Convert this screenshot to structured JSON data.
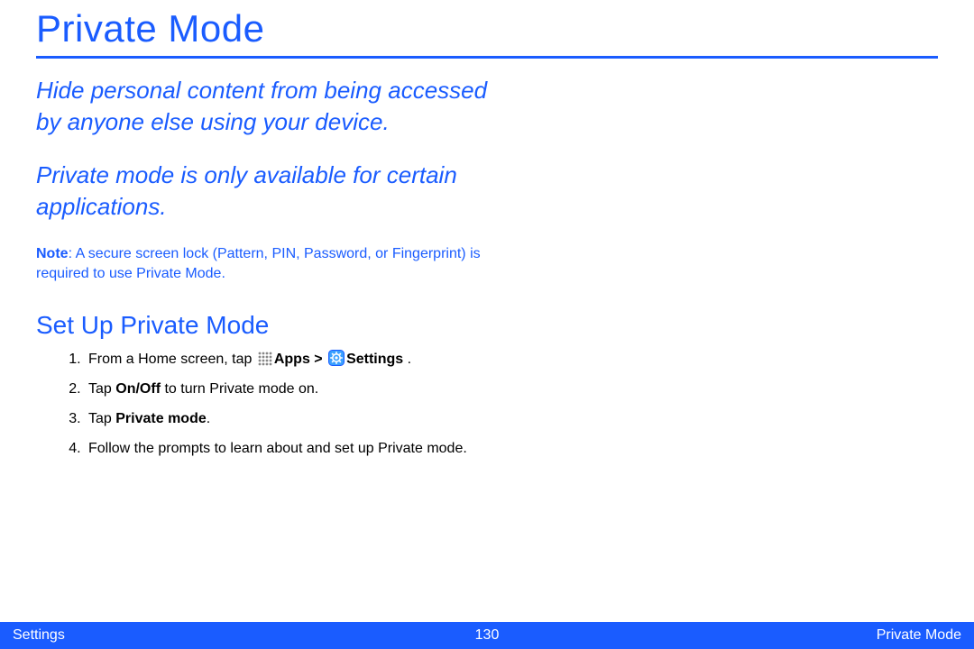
{
  "title": "Private Mode",
  "intro": {
    "p1": "Hide personal content from being accessed by anyone else using your device.",
    "p2": "Private mode is only available for certain applications."
  },
  "note": {
    "label": "Note",
    "text": ": A secure screen lock (Pattern, PIN, Password, or Fingerprint) is required to use Private Mode."
  },
  "section_heading": "Set Up Private Mode",
  "steps": {
    "s1_a": "From a Home screen, tap ",
    "s1_apps": "Apps",
    "s1_sep": " > ",
    "s1_settings": "Settings",
    "s1_end": " .",
    "s2_a": "Tap ",
    "s2_b": "On/Off",
    "s2_c": " to turn Private mode on.",
    "s3_a": "Tap ",
    "s3_b": "Private mode",
    "s3_c": ".",
    "s4": "Follow the prompts to learn about and set up Private mode."
  },
  "footer": {
    "left": "Settings",
    "center": "130",
    "right": "Private Mode"
  },
  "icons": {
    "apps": "apps-grid-icon",
    "settings": "settings-gear-icon"
  }
}
